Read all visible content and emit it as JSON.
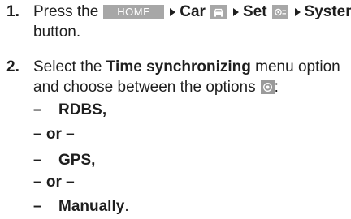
{
  "step1": {
    "number": "1.",
    "press": "Press the",
    "home_key": "HOME",
    "car": "Car",
    "set": "Set",
    "system": "System",
    "button_word": "button."
  },
  "step2": {
    "number": "2.",
    "select": "Select the",
    "menu_option": "Time synchronizing",
    "menu_option_rest": "menu option",
    "line2": "and choose between the options",
    "colon": ":",
    "options": [
      {
        "dash": "–",
        "label": "RDBS,"
      },
      {
        "separator": "– or –"
      },
      {
        "dash": "–",
        "label": "GPS,"
      },
      {
        "separator": "– or –"
      },
      {
        "dash": "–",
        "label": "Manually",
        "suffix": "."
      }
    ]
  },
  "icons": {
    "home_key": "home-key",
    "nav_arrow": "right-triangle-arrow",
    "car": "car-icon",
    "set": "settings-icon",
    "radio": "radio-button-icon"
  },
  "colors": {
    "key_background": "#a7a7a7",
    "text": "#1e1e1e"
  }
}
